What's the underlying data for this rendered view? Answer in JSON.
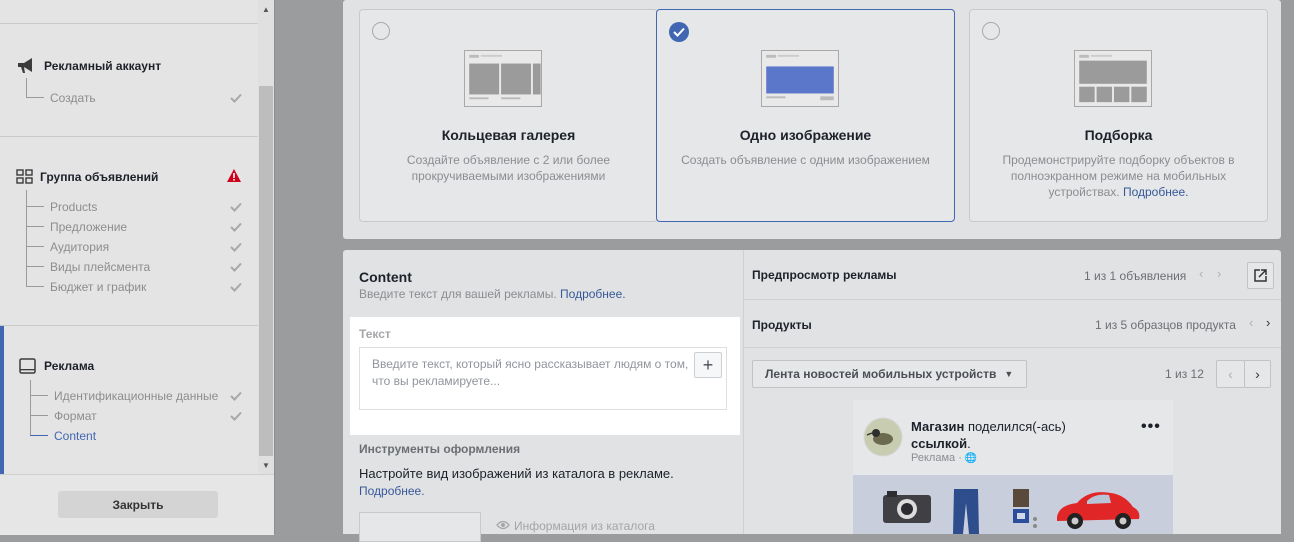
{
  "sidebar": {
    "sections": [
      {
        "title": "Рекламный аккаунт",
        "icon": "megaphone-icon",
        "items": [
          {
            "label": "Создать",
            "done": true
          }
        ]
      },
      {
        "title": "Группа объявлений",
        "icon": "ad-set-grid-icon",
        "status_icon": "warning-icon",
        "items": [
          {
            "label": "Products",
            "done": true
          },
          {
            "label": "Предложение",
            "done": true
          },
          {
            "label": "Аудитория",
            "done": true
          },
          {
            "label": "Виды плейсмента",
            "done": true
          },
          {
            "label": "Бюджет и график",
            "done": true
          }
        ]
      },
      {
        "title": "Реклама",
        "icon": "ad-tablet-icon",
        "items": [
          {
            "label": "Идентификационные данные",
            "done": true
          },
          {
            "label": "Формат",
            "done": true
          },
          {
            "label": "Content",
            "done": false,
            "active": true
          }
        ]
      }
    ],
    "close_label": "Закрыть"
  },
  "formats": [
    {
      "title": "Кольцевая галерея",
      "desc": "Создайте объявление с 2 или более прокручиваемыми изображениями",
      "selected": false
    },
    {
      "title": "Одно изображение",
      "desc": "Создать объявление с одним изображением",
      "selected": true
    },
    {
      "title": "Подборка",
      "desc": "Продемонстрируйте подборку объектов в полноэкранном режиме на мобильных устройствах.",
      "link": "Подробнее.",
      "selected": false
    }
  ],
  "content": {
    "title": "Content",
    "subtitle": "Введите текст для вашей рекламы.",
    "subtitle_link": "Подробнее.",
    "text_label": "Текст",
    "text_placeholder": "Введите текст, который ясно рассказывает людям о том, что вы рекламируете...",
    "tools_title": "Инструменты оформления",
    "tools_desc": "Настройте вид изображений из каталога в рекламе.",
    "tools_link": "Подробнее.",
    "catalog_info": "Информация из каталога"
  },
  "preview": {
    "title": "Предпросмотр рекламы",
    "counter": "1 из 1 объявления",
    "products_label": "Продукты",
    "products_counter": "1 из 5 образцов продукта",
    "placement": "Лента новостей мобильных устройств",
    "placement_counter": "1 из 12",
    "post_author": "Магазин",
    "post_action": "поделился(-ась)",
    "post_object": "ссылкой",
    "post_period": ".",
    "post_sub": "Реклама",
    "post_sub_sep": "·"
  },
  "colors": {
    "accent": "#4267b2",
    "warning": "#d0021b",
    "link": "#365899"
  }
}
